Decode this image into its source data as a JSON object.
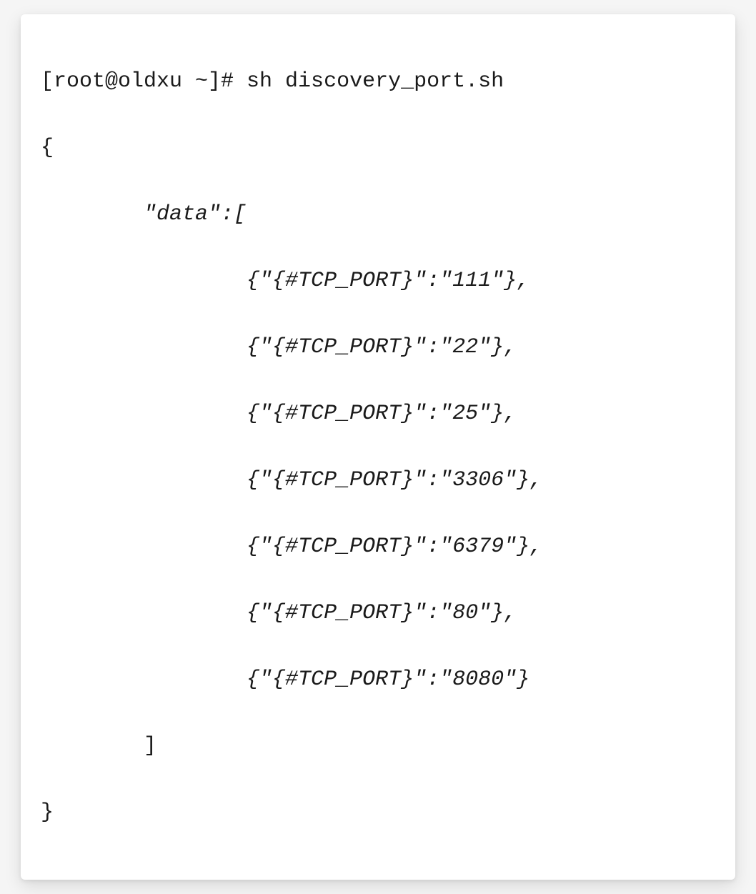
{
  "terminal": {
    "prompt": "[root@oldxu ~]# ",
    "command": "sh discovery_port.sh",
    "output": {
      "open_brace": "{",
      "data_open": "        \"data\":[",
      "entries": [
        "                {\"{#TCP_PORT}\":\"111\"},",
        "                {\"{#TCP_PORT}\":\"22\"},",
        "                {\"{#TCP_PORT}\":\"25\"},",
        "                {\"{#TCP_PORT}\":\"3306\"},",
        "                {\"{#TCP_PORT}\":\"6379\"},",
        "                {\"{#TCP_PORT}\":\"80\"},",
        "                {\"{#TCP_PORT}\":\"8080\"}"
      ],
      "data_close": "        ]",
      "close_brace": "}"
    }
  }
}
